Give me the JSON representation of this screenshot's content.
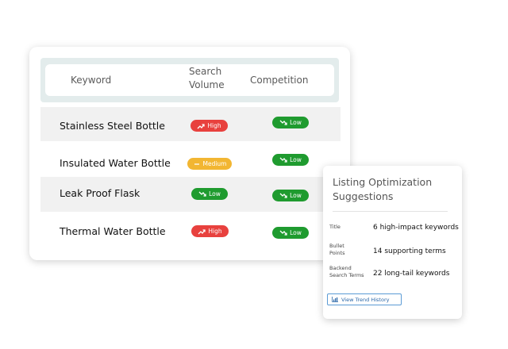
{
  "table": {
    "headers": {
      "keyword": "Keyword",
      "search_volume": "Search Volume",
      "competition": "Competition"
    },
    "rows": [
      {
        "keyword": "Stainless Steel Bottle",
        "volume": "High",
        "competition": "Low"
      },
      {
        "keyword": "Insulated Water Bottle",
        "volume": "Medium",
        "competition": "Low"
      },
      {
        "keyword": "Leak Proof Flask",
        "volume": "Low",
        "competition": "Low"
      },
      {
        "keyword": "Thermal Water Bottle",
        "volume": "High",
        "competition": "Low"
      }
    ]
  },
  "suggestions": {
    "title": "Listing Optimization Suggestions",
    "items": [
      {
        "label": "Title",
        "value": "6 high-impact keywords"
      },
      {
        "label": "Bullet Points",
        "value": "14 supporting terms"
      },
      {
        "label": "Backend Search Terms",
        "value": "22 long-tail keywords"
      }
    ],
    "button_label": "View Trend History"
  },
  "colors": {
    "high": "#e8413e",
    "low": "#1f9b2f",
    "medium": "#f2b632",
    "header_band": "#e3ecec"
  },
  "icons": {
    "high": "trend-up-icon",
    "low": "trend-down-icon",
    "medium": "dash-icon",
    "button": "chart-icon"
  }
}
